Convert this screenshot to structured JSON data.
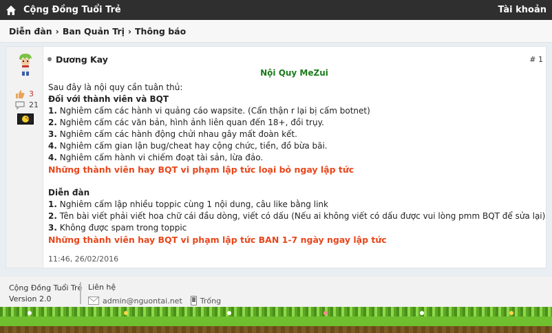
{
  "topbar": {
    "site_title": "Cộng Đồng Tuổi Trẻ",
    "account": "Tài khoản"
  },
  "breadcrumb": {
    "items": [
      "Diễn đàn",
      "Ban Quản Trị",
      "Thông báo"
    ],
    "separator": "›"
  },
  "post": {
    "author": "Dương Kay",
    "number": "# 1",
    "likes": "3",
    "comments": "21",
    "title": "Nội Quy MeZui",
    "intro": "Sau đây là nội quy cần tuân thủ:",
    "section1_title": "Đối với thành viên và BQT",
    "section1_rules": [
      {
        "num": "1.",
        "text": " Nghiêm cấm các hành vi quảng cáo wapsite. (Cẩn thận r lại bị cấm botnet)"
      },
      {
        "num": "2.",
        "text": " Nghiêm cấm các văn bản, hình ảnh liên quan đến 18+, đồi trụy."
      },
      {
        "num": "3.",
        "text": " Nghiêm cấm các hành động chửi nhau gây mất đoàn kết."
      },
      {
        "num": "4.",
        "text": " Nghiêm cấm gian lận bug/cheat hay cộng chức, tiền, đồ bừa bãi."
      },
      {
        "num": "4.",
        "text": " Nghiêm cấm hành vi chiếm đoạt tài sản, lừa đảo."
      }
    ],
    "section1_warning": "Những thành viên hay BQT vi phạm lập tức loại bỏ ngay lập tức",
    "section2_title": "Diễn đàn",
    "section2_rules": [
      {
        "num": "1.",
        "text": " Nghiêm cấm lập nhiều toppic cùng 1 nội dung, câu like bằng link"
      },
      {
        "num": "2.",
        "text": " Tên bài viết phải viết hoa chữ cái đầu dòng, viết có dấu (Nếu ai không viết có dấu được vui lòng pmm BQT để sửa lại)"
      },
      {
        "num": "3.",
        "text": " Không được spam trong toppic"
      }
    ],
    "section2_warning": "Những thành viên hay BQT vi phạm lập tức BAN 1-7 ngày ngay lập tức",
    "time": "11:46, 26/02/2016"
  },
  "footer": {
    "site_name": "Cộng Đồng Tuổi Trẻ",
    "version": "Version 2.0",
    "contact_label": "Liên hệ",
    "email": "admin@nguontai.net",
    "phone": "Trống"
  },
  "colors": {
    "topbar": "#2f2f2f",
    "title_green": "#1a7a1a",
    "warning": "#e8461b",
    "grass": "#6fbf2f"
  }
}
